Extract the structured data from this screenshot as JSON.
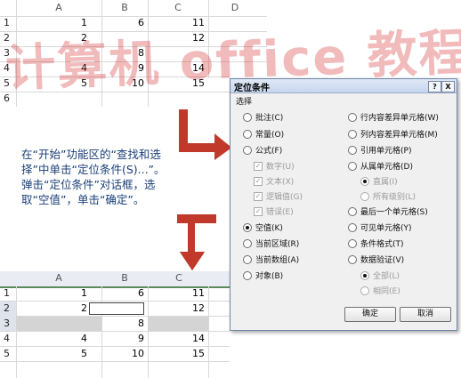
{
  "top_sheet": {
    "columns": [
      "A",
      "B",
      "C",
      "D"
    ],
    "rows": [
      "1",
      "2",
      "3",
      "4",
      "5",
      "6"
    ],
    "cells": [
      [
        "1",
        "6",
        "11"
      ],
      [
        "2",
        "",
        "12"
      ],
      [
        "",
        "8",
        ""
      ],
      [
        "4",
        "9",
        "14"
      ],
      [
        "5",
        "10",
        "15"
      ],
      [
        "",
        "",
        ""
      ]
    ]
  },
  "bottom_sheet": {
    "columns": [
      "A",
      "B",
      "C"
    ],
    "rows": [
      "1",
      "2",
      "3",
      "4",
      "5"
    ],
    "cells": [
      [
        "1",
        "6",
        "11"
      ],
      [
        "2",
        "",
        "12"
      ],
      [
        "",
        "8",
        ""
      ],
      [
        "4",
        "9",
        "14"
      ],
      [
        "5",
        "10",
        "15"
      ]
    ]
  },
  "instruction": "在“开始”功能区的“查找和选择”中单击“定位条件(S)...”。弹击“定位条件”对话框，选取“空值”，单击“确定”。",
  "watermark": "计算机 office 教程网",
  "dialog": {
    "title": "定位条件",
    "help_btn": "?",
    "close_btn": "X",
    "group_label": "选择",
    "left_options": [
      "批注(C)",
      "常量(O)",
      "公式(F)",
      "数字(U)",
      "文本(X)",
      "逻辑值(G)",
      "错误(E)",
      "空值(K)",
      "当前区域(R)",
      "当前数组(A)",
      "对象(B)"
    ],
    "right_options": [
      "行内容差异单元格(W)",
      "列内容差异单元格(M)",
      "引用单元格(P)",
      "从属单元格(D)",
      "直属(I)",
      "所有级别(L)",
      "最后一个单元格(S)",
      "可见单元格(Y)",
      "条件格式(T)",
      "数据验证(V)",
      "全部(L)",
      "相同(E)"
    ],
    "ok": "确定",
    "cancel": "取消"
  },
  "colors": {
    "arrow": "#c0392b",
    "selection": "#d4d4d4",
    "watermark": "#d21e1e"
  }
}
